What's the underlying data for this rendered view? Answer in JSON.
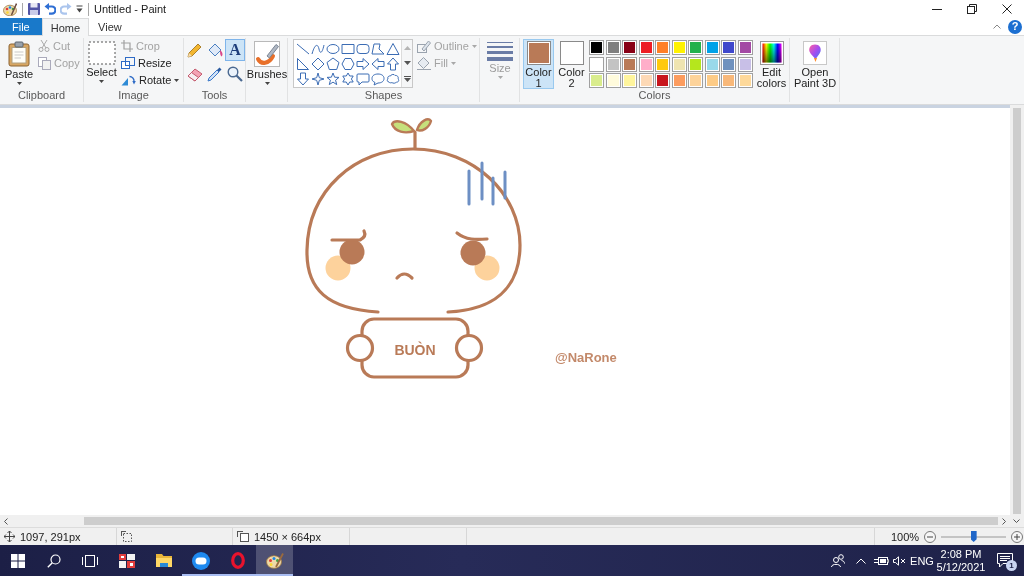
{
  "title_bar": {
    "title": "Untitled - Paint",
    "quick_access": [
      {
        "kind": "app",
        "disabled": false
      },
      {
        "kind": "save",
        "disabled": false
      },
      {
        "kind": "undo",
        "disabled": false
      },
      {
        "kind": "redo",
        "disabled": true
      },
      {
        "kind": "customize",
        "disabled": false
      }
    ]
  },
  "tabs": [
    {
      "label": "File",
      "kind": "file",
      "selected": false
    },
    {
      "label": "Home",
      "kind": "tab",
      "selected": true
    },
    {
      "label": "View",
      "kind": "tab",
      "selected": false
    }
  ],
  "help_button": {
    "glyph": "?"
  },
  "ribbon": {
    "clipboard": {
      "label": "Clipboard",
      "paste": "Paste",
      "cut": {
        "label": "Cut",
        "disabled": true
      },
      "copy": {
        "label": "Copy",
        "disabled": true
      }
    },
    "image": {
      "label": "Image",
      "select": "Select",
      "crop": {
        "label": "Crop",
        "disabled": true
      },
      "resize": {
        "label": "Resize",
        "disabled": false
      },
      "rotate": {
        "label": "Rotate",
        "disabled": false
      }
    },
    "tools": {
      "label": "Tools",
      "items": [
        {
          "kind": "pencil",
          "selected": false
        },
        {
          "kind": "fill",
          "selected": false
        },
        {
          "kind": "text",
          "glyph": "A",
          "selected": true
        },
        {
          "kind": "eraser",
          "selected": false
        },
        {
          "kind": "picker",
          "selected": false
        },
        {
          "kind": "magnifier",
          "selected": false
        }
      ]
    },
    "brushes": {
      "label": "Brushes"
    },
    "shapes": {
      "label": "Shapes",
      "outline": {
        "label": "Outline",
        "disabled": true
      },
      "fill": {
        "label": "Fill",
        "disabled": true
      }
    },
    "size": {
      "label": "Size",
      "disabled": true
    },
    "colors": {
      "label": "Colors",
      "color_1": {
        "label": "Color 1",
        "color": "#b97a57",
        "selected": true
      },
      "color_2": {
        "label": "Color 2",
        "color": "#ffffff",
        "selected": false
      },
      "palette": [
        {
          "color": "#000000"
        },
        {
          "color": "#7f7f7f"
        },
        {
          "color": "#880015"
        },
        {
          "color": "#ed1c24"
        },
        {
          "color": "#ff7f27"
        },
        {
          "color": "#fff200"
        },
        {
          "color": "#22b14c"
        },
        {
          "color": "#00a2e8"
        },
        {
          "color": "#3f48cc"
        },
        {
          "color": "#a349a4"
        },
        {
          "color": "#ffffff"
        },
        {
          "color": "#c3c3c3"
        },
        {
          "color": "#b97a57"
        },
        {
          "color": "#ffaec9"
        },
        {
          "color": "#ffc90e"
        },
        {
          "color": "#efe4b0"
        },
        {
          "color": "#b5e61d"
        },
        {
          "color": "#99d9ea"
        },
        {
          "color": "#7092be"
        },
        {
          "color": "#c8bfe7"
        },
        {
          "color": "#d9ec8c"
        },
        {
          "color": "#fffbdc"
        },
        {
          "color": "#fff59d"
        },
        {
          "color": "#fdd9b5"
        },
        {
          "color": "#c8161d"
        },
        {
          "color": "#fc9c5f"
        },
        {
          "color": "#fdd39a"
        },
        {
          "color": "#fdcb86"
        },
        {
          "color": "#f8b879"
        },
        {
          "color": "#fed99a"
        }
      ],
      "edit_colors": "Edit colors"
    },
    "paint_3d": {
      "label": "Open Paint 3D"
    }
  },
  "canvas": {
    "sign_text": "BUÒN",
    "signature": "@NaRone"
  },
  "status_bar": {
    "cursor_position": "1097, 291px",
    "canvas_size": "1450 × 664px",
    "zoom": "100%",
    "zoom_slider": {
      "level": 0.5
    }
  },
  "taskbar": {
    "apps": [
      {
        "kind": "tiles",
        "running": false,
        "selected": false
      },
      {
        "kind": "explorer",
        "running": false,
        "selected": false
      },
      {
        "kind": "chat",
        "running": true,
        "selected": false
      },
      {
        "kind": "browser",
        "running": true,
        "selected": false
      },
      {
        "kind": "paint",
        "running": true,
        "selected": true
      }
    ],
    "language": "ENG",
    "time": "2:08 PM",
    "date": "5/12/2021",
    "notifications": "1"
  }
}
